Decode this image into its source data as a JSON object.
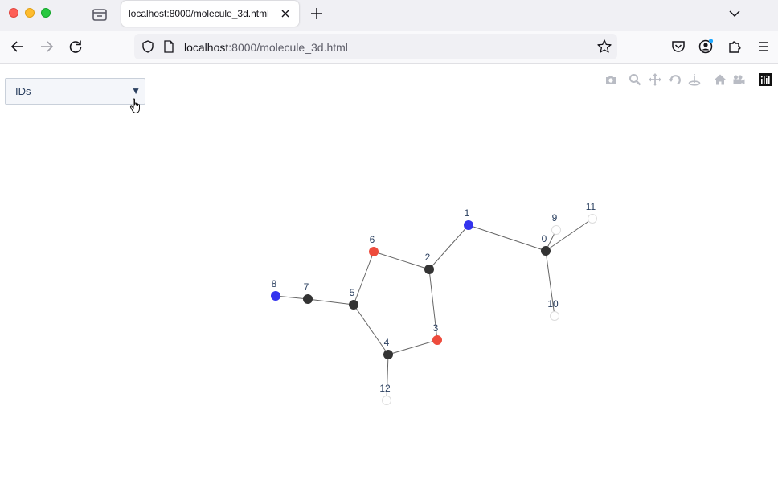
{
  "browser": {
    "tab_title": "localhost:8000/molecule_3d.html",
    "url_host": "localhost",
    "url_rest": ":8000/molecule_3d.html"
  },
  "icons": {
    "back": "arrow-left-icon",
    "forward": "arrow-right-icon",
    "reload": "reload-icon",
    "shield": "shield-icon",
    "page": "page-icon",
    "bookmark": "star-icon",
    "pocket": "pocket-icon",
    "account": "account-icon",
    "extensions": "puzzle-icon",
    "menu": "hamburger-icon"
  },
  "controls": {
    "dropdown_label": "IDs",
    "dropdown_arrow": "▼"
  },
  "colors": {
    "carbon": "#333333",
    "nitrogen": "#3333ee",
    "oxygen": "#ee4b3c",
    "hydrogen": "#ffffff",
    "bond": "#666666"
  },
  "molecule": {
    "atoms": [
      {
        "id": "0",
        "element": "C"
      },
      {
        "id": "1",
        "element": "N"
      },
      {
        "id": "2",
        "element": "C"
      },
      {
        "id": "3",
        "element": "O"
      },
      {
        "id": "4",
        "element": "C"
      },
      {
        "id": "5",
        "element": "C"
      },
      {
        "id": "6",
        "element": "O"
      },
      {
        "id": "7",
        "element": "C"
      },
      {
        "id": "8",
        "element": "N"
      },
      {
        "id": "9",
        "element": "H"
      },
      {
        "id": "10",
        "element": "H"
      },
      {
        "id": "11",
        "element": "H"
      },
      {
        "id": "12",
        "element": "H"
      }
    ],
    "bonds": [
      [
        0,
        1
      ],
      [
        1,
        2
      ],
      [
        2,
        3
      ],
      [
        3,
        4
      ],
      [
        4,
        5
      ],
      [
        5,
        6
      ],
      [
        6,
        2
      ],
      [
        5,
        7
      ],
      [
        7,
        8
      ],
      [
        0,
        9
      ],
      [
        0,
        10
      ],
      [
        0,
        11
      ],
      [
        4,
        12
      ]
    ]
  }
}
